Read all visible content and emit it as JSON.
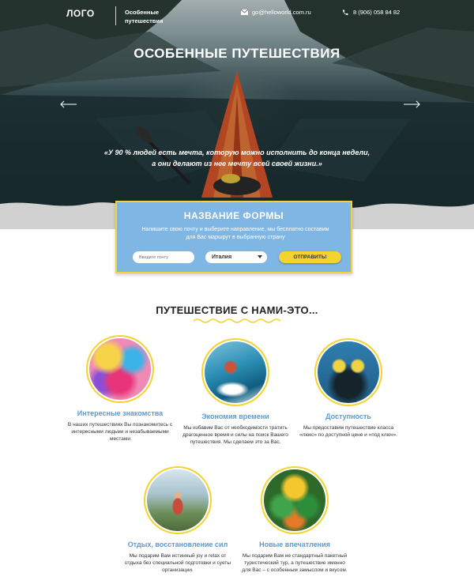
{
  "header": {
    "logo": "ЛОГО",
    "tagline": "Особенные путешествия",
    "email": "go@helloworld.com.ru",
    "phone": "8 (906) 058 84 82"
  },
  "hero": {
    "title": "ОСОБЕННЫЕ ПУТЕШЕСТВИЯ",
    "quote": "«У 90 % людей есть мечта, которую можно исполнить до конца недели, а они делают из нее мечту всей своей жизни.»"
  },
  "form": {
    "title": "НАЗВАНИЕ ФОРМЫ",
    "description": "Напишите свою почту и выберите направление, мы бесплатно составим для Вас маршрут в выбранную страну",
    "email_placeholder": "Введите почту",
    "country_selected": "Италия",
    "submit_label": "ОТПРАВИТЬ!"
  },
  "section": {
    "title": "ПУТЕШЕСТВИЕ С НАМИ-ЭТО..."
  },
  "features": [
    {
      "title": "Интересные знакомства",
      "text": "В наших путешествиях Вы познакомитесь с интересными людьми и незабываемыми местами"
    },
    {
      "title": "Экономия времени",
      "text": "Мы избавим Вас от необходимости тратить драгоценное время и силы на поиск Вашего путешествия. Мы сделаем это за Вас."
    },
    {
      "title": "Доступность",
      "text": "Мы предоставим путешествие класса «люкс» по доступной цене и «под ключ»."
    },
    {
      "title": "Отдых, восстановление сил",
      "text": "Мы подарим Вам истинный joy и relax от отдыха без специальной подготовки и суеты организации."
    },
    {
      "title": "Новые впечатления",
      "text": "Мы подарим Вам не стандартный пакетный туристический тур, а путешествие именно для Вас – с особенным замыслом и вкусом."
    }
  ],
  "colors": {
    "accent_yellow": "#f4d32f",
    "form_blue": "#7fb6e3",
    "feature_title_blue": "#5a9ad5"
  },
  "icons": [
    "envelope-icon",
    "phone-icon",
    "arrow-left-icon",
    "arrow-right-icon"
  ]
}
